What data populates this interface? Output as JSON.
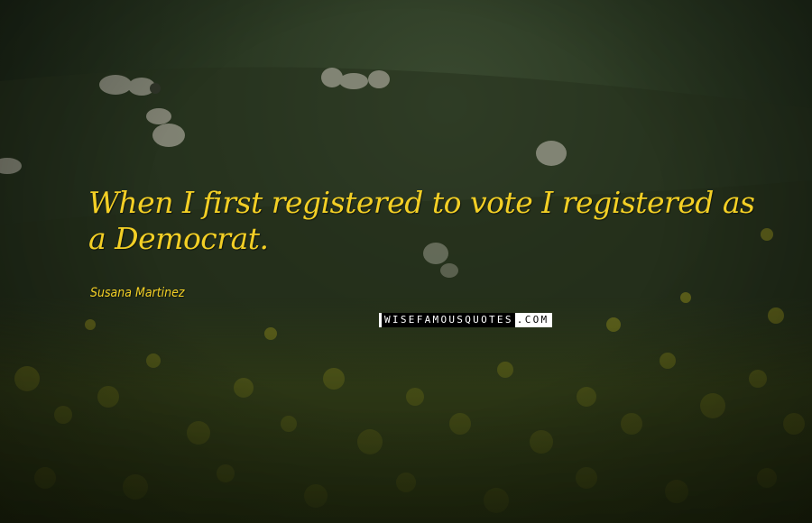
{
  "quote": {
    "text": "When I first registered to vote I registered as a Democrat.",
    "author": "Susana Martinez"
  },
  "watermark": {
    "brand": "WISEFAMOUSQUOTES",
    "suffix": ".COM"
  },
  "colors": {
    "quote_text": "#f3cf25",
    "background": "#1c2416"
  }
}
